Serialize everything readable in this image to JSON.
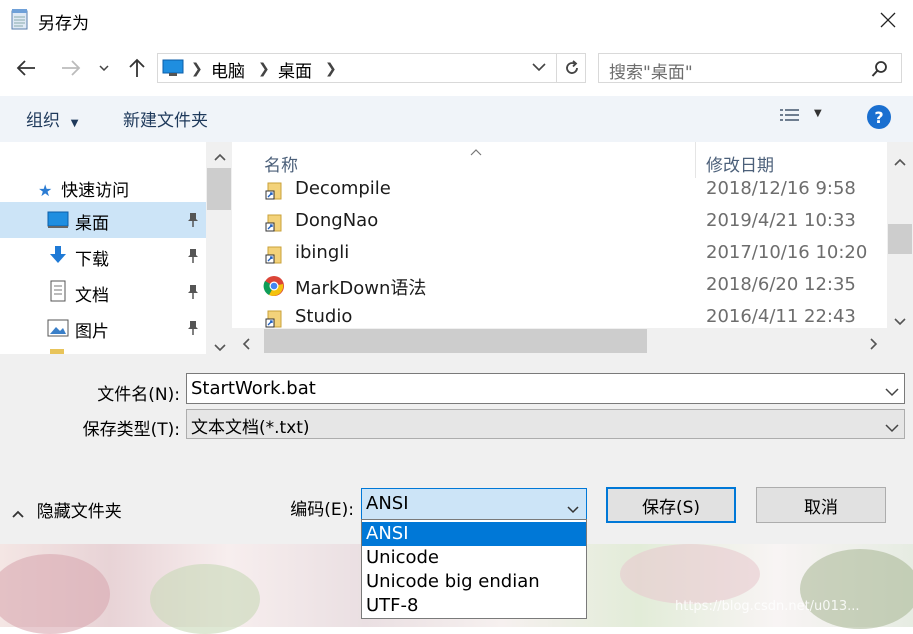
{
  "window": {
    "title": "另存为"
  },
  "address": {
    "path": [
      "电脑",
      "桌面"
    ]
  },
  "search": {
    "placeholder": "搜索\"桌面\""
  },
  "toolbar": {
    "organize": "组织",
    "new_folder": "新建文件夹"
  },
  "nav": {
    "quick_access": "快速访问",
    "items": [
      {
        "label": "桌面",
        "icon": "desktop-icon",
        "pinned": true,
        "selected": true
      },
      {
        "label": "下载",
        "icon": "download-icon",
        "pinned": true
      },
      {
        "label": "文档",
        "icon": "document-icon",
        "pinned": true
      },
      {
        "label": "图片",
        "icon": "picture-icon",
        "pinned": true
      }
    ]
  },
  "list": {
    "col_name": "名称",
    "col_date": "修改日期",
    "rows": [
      {
        "name": "Decompile",
        "date": "2018/12/16 9:58",
        "icon": "folder-shortcut-icon"
      },
      {
        "name": "DongNao",
        "date": "2019/4/21 10:33",
        "icon": "folder-shortcut-icon"
      },
      {
        "name": "ibingli",
        "date": "2017/10/16 10:20",
        "icon": "folder-shortcut-icon"
      },
      {
        "name": "MarkDown语法",
        "date": "2018/6/20 12:35",
        "icon": "chrome-icon"
      },
      {
        "name": "Studio",
        "date": "2016/4/11 22:43",
        "icon": "folder-shortcut-icon"
      }
    ]
  },
  "form": {
    "filename_label": "文件名(N):",
    "filename_value": "StartWork.bat",
    "filetype_label": "保存类型(T):",
    "filetype_value": "文本文档(*.txt)",
    "hide_folders": "隐藏文件夹",
    "encoding_label": "编码(E):",
    "encoding_value": "ANSI",
    "encoding_options": [
      "ANSI",
      "Unicode",
      "Unicode big endian",
      "UTF-8"
    ],
    "save": "保存(S)",
    "cancel": "取消"
  },
  "watermark": "https://blog.csdn.net/u013...",
  "colors": {
    "accent": "#0078d7",
    "selection": "#cce8ff",
    "nav_selected": "#cce4f7",
    "help": "#1a6fd0"
  }
}
